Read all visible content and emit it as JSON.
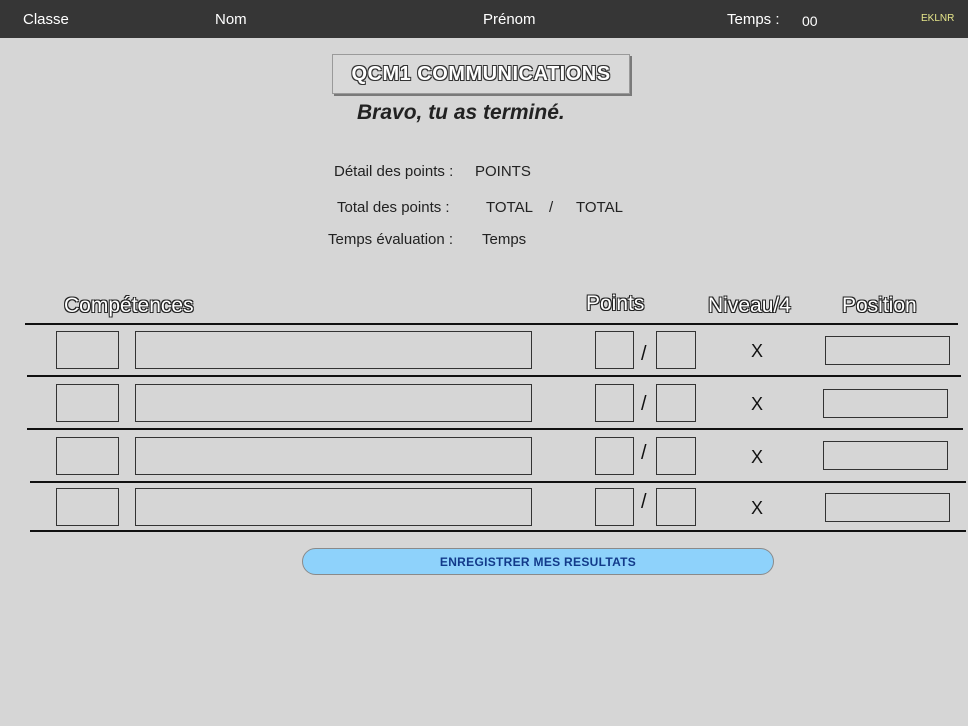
{
  "header": {
    "classe": "Classe",
    "nom": "Nom",
    "prenom": "Prénom",
    "temps_label": "Temps :",
    "temps_value": "00",
    "brand": "EKLNR"
  },
  "quiz": {
    "title": "QCM1 COMMUNICATIONS",
    "message": "Bravo, tu as terminé."
  },
  "summary": {
    "detail_label": "Détail des points :",
    "detail_value": "POINTS",
    "total_label": "Total des points :",
    "total_score": "TOTAL",
    "total_sep": "/",
    "total_max": "TOTAL",
    "time_label": "Temps évaluation :",
    "time_value": "Temps"
  },
  "table": {
    "headers": {
      "competences": "Compétences",
      "points": "Points",
      "niveau": "Niveau/4",
      "position": "Position"
    },
    "rows": [
      {
        "code": "",
        "competence": "",
        "points": "",
        "max": "",
        "sep": "/",
        "niveau": "X",
        "position": ""
      },
      {
        "code": "",
        "competence": "",
        "points": "",
        "max": "",
        "sep": "/",
        "niveau": "X",
        "position": ""
      },
      {
        "code": "",
        "competence": "",
        "points": "",
        "max": "",
        "sep": "/",
        "niveau": "X",
        "position": ""
      },
      {
        "code": "",
        "competence": "",
        "points": "",
        "max": "",
        "sep": "/",
        "niveau": "X",
        "position": ""
      }
    ]
  },
  "actions": {
    "save_label": "ENREGISTRER MES RESULTATS"
  }
}
